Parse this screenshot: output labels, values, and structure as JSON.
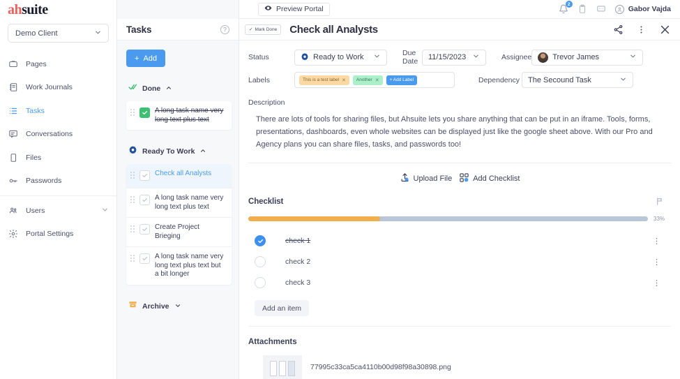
{
  "brand": {
    "logo_part1": "ah",
    "logo_part2": "suite",
    "accent_red": "#e8625e",
    "accent_blue": "#4a9bf0"
  },
  "sidebar": {
    "client_selector": {
      "value": "Demo Client",
      "icon": "chevron-down-icon"
    },
    "items": [
      {
        "label": "Pages",
        "icon": "pages-icon",
        "active": false
      },
      {
        "label": "Work Journals",
        "icon": "journal-icon",
        "active": false
      },
      {
        "label": "Tasks",
        "icon": "tasks-list-icon",
        "active": true
      },
      {
        "label": "Conversations",
        "icon": "conversations-icon",
        "active": false
      },
      {
        "label": "Files",
        "icon": "files-icon",
        "active": false
      },
      {
        "label": "Passwords",
        "icon": "key-icon",
        "active": false
      },
      {
        "label": "Users",
        "icon": "users-icon",
        "active": false,
        "expandable": true
      },
      {
        "label": "Portal Settings",
        "icon": "gear-icon",
        "active": false
      }
    ]
  },
  "tasks_panel": {
    "title": "Tasks",
    "help_glyph": "?",
    "add_button": "Add",
    "add_plus": "+",
    "groups": [
      {
        "name": "Done",
        "icon": "double-check-icon",
        "chevron": "chevron-up-icon",
        "tasks": [
          {
            "name": "A long task name very long text plus text",
            "done": true,
            "selected": false
          }
        ]
      },
      {
        "name": "Ready To Work",
        "icon": "gear-status-icon",
        "chevron": "chevron-up-icon",
        "tasks": [
          {
            "name": "Check all Analysts",
            "done": false,
            "selected": true
          },
          {
            "name": "A long task name very long text plus text",
            "done": false,
            "selected": false
          },
          {
            "name": "Create Project Brieging",
            "done": false,
            "selected": false
          },
          {
            "name": "A long task name very long text plus text but a bit longer",
            "done": false,
            "selected": false
          }
        ]
      },
      {
        "name": "Archive",
        "icon": "archive-box-icon",
        "chevron": "chevron-down-icon",
        "tasks": []
      }
    ]
  },
  "topbar": {
    "preview_portal": "Preview Portal",
    "preview_icon": "eye-icon",
    "notification_badge": "2",
    "icons": [
      "bell-icon",
      "clipboard-icon",
      "chat-icon"
    ],
    "user_name": "Gabor Vajda"
  },
  "detail": {
    "mark_done_label": "Mark Done",
    "mark_done_check": "✓",
    "title": "Check all Analysts",
    "actions": [
      "share-icon",
      "more-vertical-icon",
      "close-icon"
    ],
    "fields": {
      "status_label": "Status",
      "status_value": "Ready to Work",
      "due_date_label": "Due Date",
      "due_date_value": "11/15/2023",
      "assignee_label": "Assignee",
      "assignee_value": "Trevor James",
      "labels_label": "Labels",
      "dependency_label": "Dependency",
      "dependency_value": "The Secound Task",
      "labels": [
        {
          "text": "This is a test label",
          "color": "orange",
          "close": "✕"
        },
        {
          "text": "Another",
          "color": "green",
          "close": "✕"
        }
      ],
      "add_label_button": "+ Add Label"
    },
    "description_label": "Description",
    "description_text": "There are lots of tools for sharing files, but Ahsuite lets you share anything that can be put in an iframe. Tools, forms, presentations, dashboards, even whole websites can be displayed just like the google sheet above. With our Pro and Agency plans you can share files, tasks, and passwords too!",
    "upload_file_label": "Upload File",
    "add_checklist_label": "Add Checklist",
    "checklist": {
      "title": "Checklist",
      "progress_percent": 33,
      "progress_text": "33%",
      "progress_color": "#f0ae4d",
      "track_color": "#b9c6d8",
      "items": [
        {
          "text": "check 1",
          "checked": true
        },
        {
          "text": "check 2",
          "checked": false
        },
        {
          "text": "check 3",
          "checked": false
        }
      ],
      "add_item_label": "Add an item"
    },
    "attachments": {
      "title": "Attachments",
      "files": [
        {
          "name": "77995c33ca5ca4110b00d98f98a30898.png"
        }
      ]
    }
  }
}
